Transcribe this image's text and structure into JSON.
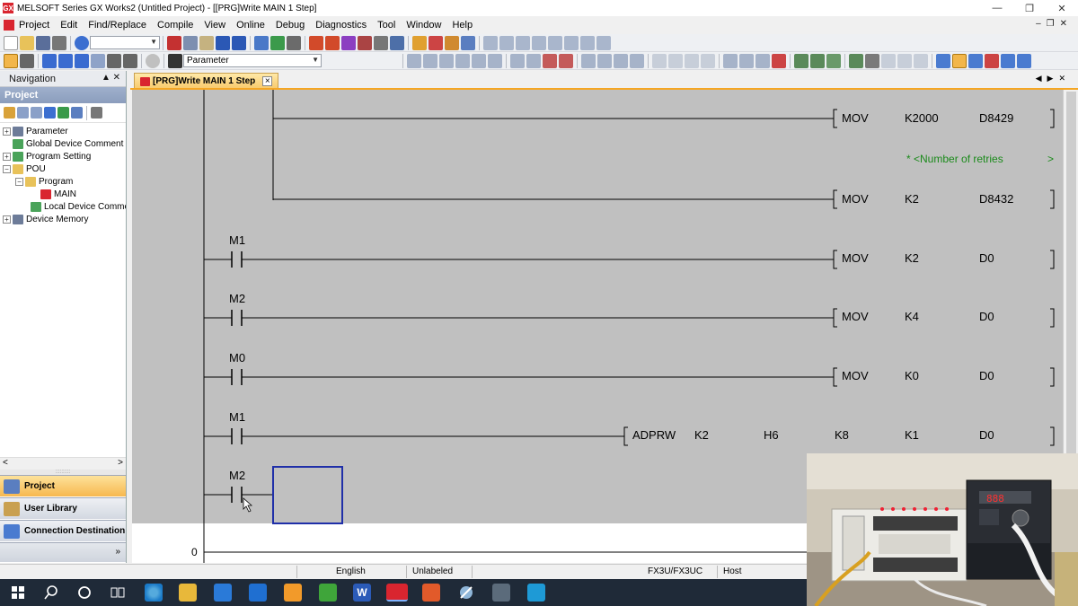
{
  "window": {
    "title": "MELSOFT Series GX Works2 (Untitled Project) - [[PRG]Write MAIN 1 Step]",
    "app_icon_text": "GX"
  },
  "menu": [
    "Project",
    "Edit",
    "Find/Replace",
    "Compile",
    "View",
    "Online",
    "Debug",
    "Diagnostics",
    "Tool",
    "Window",
    "Help"
  ],
  "toolbar": {
    "parameter_combo": "Parameter",
    "project_combo": ""
  },
  "navigation": {
    "header": "Navigation",
    "section": "Project",
    "tree": [
      {
        "label": "Parameter",
        "level": 0,
        "expander": "+"
      },
      {
        "label": "Global Device Comment",
        "level": 0,
        "expander": ""
      },
      {
        "label": "Program Setting",
        "level": 0,
        "expander": "+"
      },
      {
        "label": "POU",
        "level": 0,
        "expander": "-"
      },
      {
        "label": "Program",
        "level": 1,
        "expander": "-"
      },
      {
        "label": "MAIN",
        "level": 2,
        "expander": ""
      },
      {
        "label": "Local Device Comment",
        "level": 1,
        "expander": ""
      },
      {
        "label": "Device Memory",
        "level": 0,
        "expander": "+"
      }
    ],
    "buttons": {
      "project": "Project",
      "user_library": "User Library",
      "connection_destination": "Connection Destination"
    }
  },
  "editor": {
    "tab_label": "[PRG]Write MAIN 1 Step",
    "step_number": "0",
    "rungs": {
      "mov1": {
        "instr": "MOV",
        "op1": "K2000",
        "op2": "D8429"
      },
      "comment": "* <Number of retries",
      "comment_arrow": ">",
      "mov2": {
        "instr": "MOV",
        "op1": "K2",
        "op2": "D8432"
      },
      "r_m1": {
        "contact": "M1",
        "instr": "MOV",
        "op1": "K2",
        "op2": "D0"
      },
      "r_m2": {
        "contact": "M2",
        "instr": "MOV",
        "op1": "K4",
        "op2": "D0"
      },
      "r_m0": {
        "contact": "M0",
        "instr": "MOV",
        "op1": "K0",
        "op2": "D0"
      },
      "r_adprw": {
        "contact": "M1",
        "instr": "ADPRW",
        "op1": "K2",
        "op2": "H6",
        "op3": "K8",
        "op4": "K1",
        "op5": "D0"
      },
      "r_edit": {
        "contact": "M2"
      }
    }
  },
  "statusbar": {
    "language": "English",
    "label": "Unlabeled",
    "cpu": "FX3U/FX3UC",
    "connection": "Host"
  },
  "colors": {
    "ladder_bg": "#c0c0c0",
    "comment": "#1a8a1a",
    "cursor": "#1f2fa8",
    "tab_active": "#f8c96a",
    "taskbar": "#1f2a38"
  }
}
